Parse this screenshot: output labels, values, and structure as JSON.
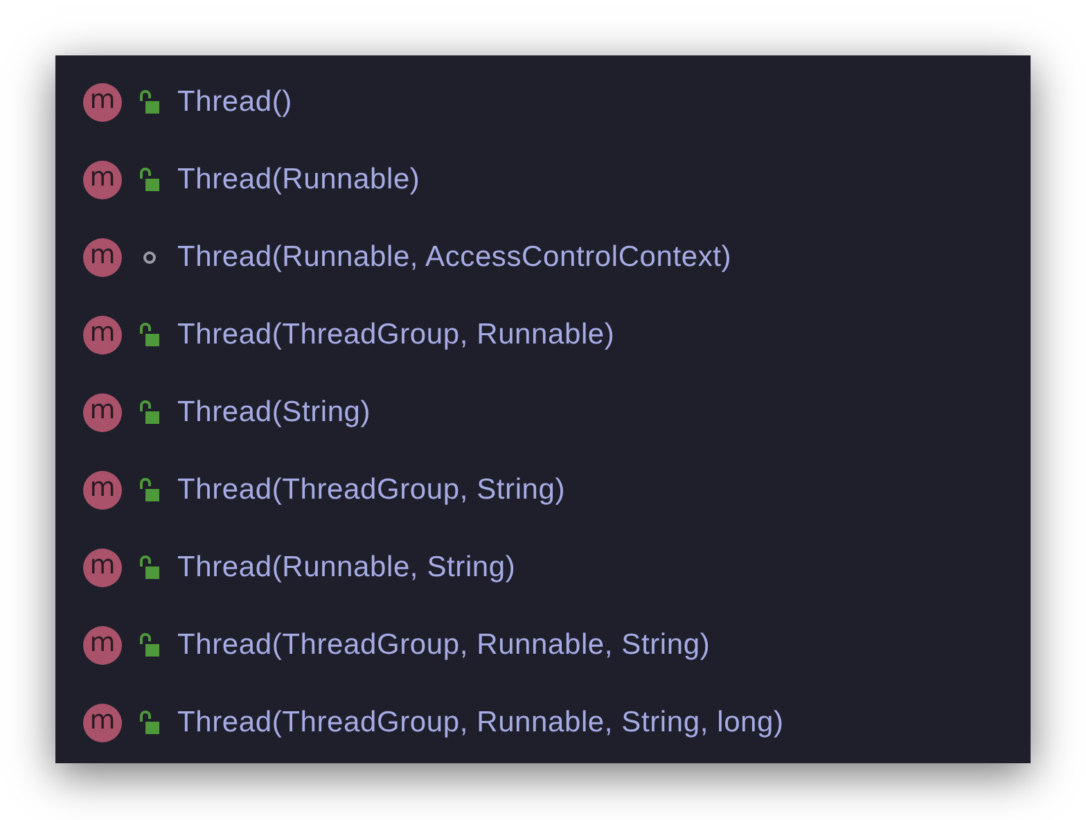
{
  "items": [
    {
      "badge": "m",
      "kind": "public",
      "label": "Thread()"
    },
    {
      "badge": "m",
      "kind": "public",
      "label": "Thread(Runnable)"
    },
    {
      "badge": "m",
      "kind": "package",
      "label": "Thread(Runnable, AccessControlContext)"
    },
    {
      "badge": "m",
      "kind": "public",
      "label": "Thread(ThreadGroup, Runnable)"
    },
    {
      "badge": "m",
      "kind": "public",
      "label": "Thread(String)"
    },
    {
      "badge": "m",
      "kind": "public",
      "label": "Thread(ThreadGroup, String)"
    },
    {
      "badge": "m",
      "kind": "public",
      "label": "Thread(Runnable, String)"
    },
    {
      "badge": "m",
      "kind": "public",
      "label": "Thread(ThreadGroup, Runnable, String)"
    },
    {
      "badge": "m",
      "kind": "public",
      "label": "Thread(ThreadGroup, Runnable, String, long)"
    }
  ]
}
